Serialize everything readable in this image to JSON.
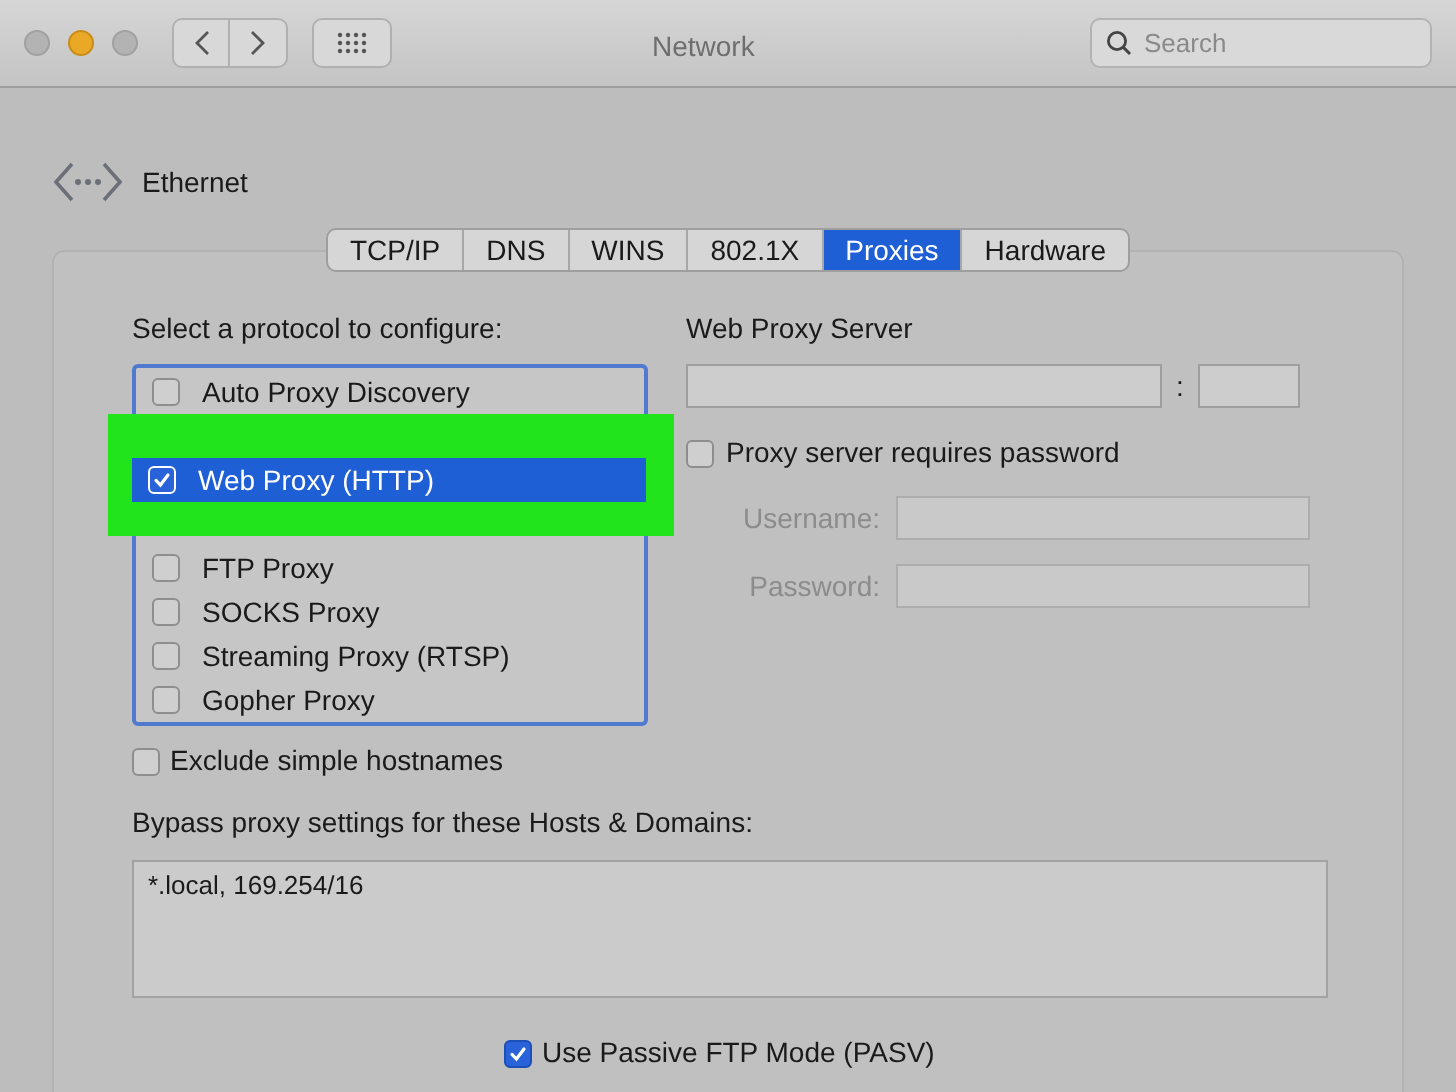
{
  "window": {
    "title": "Network",
    "search": {
      "placeholder": "Search"
    }
  },
  "interface": {
    "name": "Ethernet"
  },
  "tabs": [
    {
      "label": "TCP/IP",
      "selected": false
    },
    {
      "label": "DNS",
      "selected": false
    },
    {
      "label": "WINS",
      "selected": false
    },
    {
      "label": "802.1X",
      "selected": false
    },
    {
      "label": "Proxies",
      "selected": true
    },
    {
      "label": "Hardware",
      "selected": false
    }
  ],
  "protocols": {
    "label": "Select a protocol to configure:",
    "items": [
      {
        "label": "Auto Proxy Discovery",
        "checked": false,
        "selected": false,
        "highlighted": false
      },
      {
        "label": "Web Proxy (HTTP)",
        "checked": true,
        "selected": true,
        "highlighted": true
      },
      {
        "label": "FTP Proxy",
        "checked": false,
        "selected": false,
        "highlighted": false
      },
      {
        "label": "SOCKS Proxy",
        "checked": false,
        "selected": false,
        "highlighted": false
      },
      {
        "label": "Streaming Proxy (RTSP)",
        "checked": false,
        "selected": false,
        "highlighted": false
      },
      {
        "label": "Gopher Proxy",
        "checked": false,
        "selected": false,
        "highlighted": false
      }
    ]
  },
  "server": {
    "label": "Web Proxy Server",
    "separator": ":",
    "auth": {
      "label": "Proxy server requires password",
      "checked": false
    },
    "username": {
      "label": "Username:",
      "disabled": true
    },
    "password": {
      "label": "Password:",
      "disabled": true
    }
  },
  "exclude_simple": {
    "label": "Exclude simple hostnames",
    "checked": false
  },
  "bypass": {
    "label": "Bypass proxy settings for these Hosts & Domains:",
    "value": "*.local, 169.254/16"
  },
  "passive_ftp": {
    "label": "Use Passive FTP Mode (PASV)",
    "checked": true
  }
}
